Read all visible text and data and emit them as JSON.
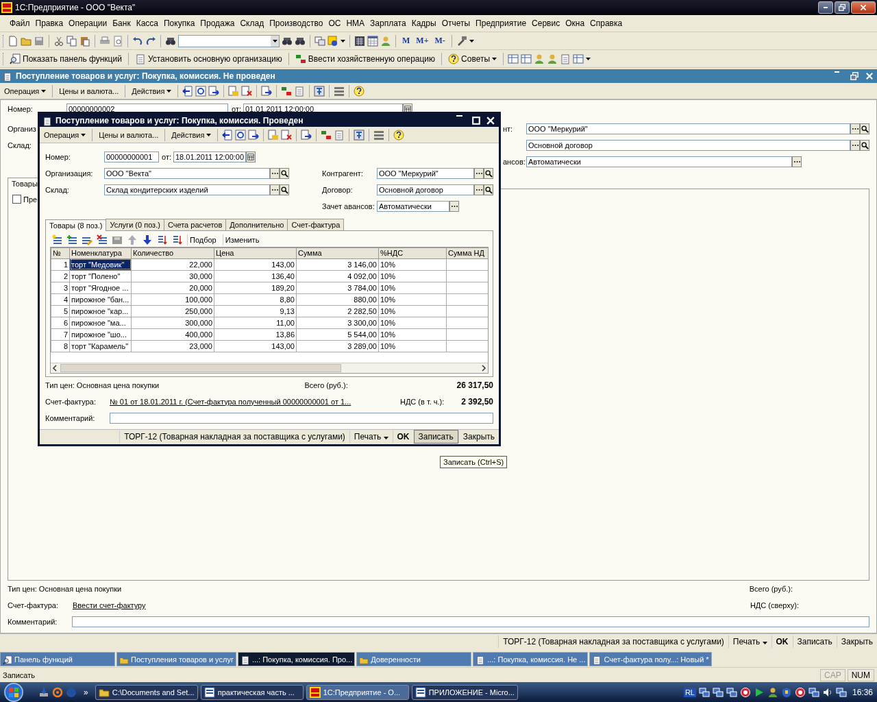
{
  "app_window": {
    "title": "1С:Предприятие - ООО \"Векта\""
  },
  "menu": [
    "Файл",
    "Правка",
    "Операции",
    "Банк",
    "Касса",
    "Покупка",
    "Продажа",
    "Склад",
    "Производство",
    "ОС",
    "НМА",
    "Зарплата",
    "Кадры",
    "Отчеты",
    "Предприятие",
    "Сервис",
    "Окна",
    "Справка"
  ],
  "memory_buttons": [
    "M",
    "M+",
    "M-"
  ],
  "function_toolbar": [
    {
      "label": "Показать панель функций",
      "dropdown": false
    },
    {
      "label": "Установить основную организацию",
      "dropdown": false
    },
    {
      "label": "Ввести хозяйственную операцию",
      "dropdown": false
    },
    {
      "label": "Советы",
      "dropdown": true
    }
  ],
  "document": {
    "title": "Поступление товаров и услуг: Покупка, комиссия. Не проведен",
    "toolbar": [
      {
        "label": "Операция",
        "dropdown": true
      },
      {
        "label": "Цены и валюта...",
        "dropdown": false
      },
      {
        "label": "Действия",
        "dropdown": true
      }
    ],
    "number_label": "Номер:",
    "number": "00000000002",
    "date_label": "от:",
    "date": "01.01.2011 12:00:00",
    "organization_label": "Организ",
    "warehouse_label": "Склад:",
    "counterparty_label": "нт:",
    "counterparty": "ООО \"Меркурий\"",
    "contract": "Основной договор",
    "advance_label": "ансов:",
    "advance": "Автоматически",
    "tab": {
      "label": "Товары",
      "selected": true
    },
    "checkbox": {
      "label": "Пре",
      "checked": false
    },
    "price_type": "Тип цен: Основная цена покупки",
    "total_label": "Всего (руб.):",
    "invoice_label": "Счет-фактура:",
    "invoice_link": "Ввести счет-фактуру",
    "vat_label": "НДС (сверху):",
    "comment_label": "Комментарий:",
    "footer": [
      {
        "label": "ТОРГ-12 (Товарная накладная за поставщика с услугами)",
        "kind": "plain"
      },
      {
        "label": "Печать",
        "kind": "menu"
      },
      {
        "label": "OK",
        "kind": "bold"
      },
      {
        "label": "Записать",
        "kind": "plain"
      },
      {
        "label": "Закрыть",
        "kind": "plain"
      }
    ]
  },
  "dialog": {
    "title": "Поступление товаров и услуг: Покупка, комиссия. Проведен",
    "toolbar": [
      {
        "label": "Операция",
        "dropdown": true
      },
      {
        "label": "Цены и валюта...",
        "dropdown": false
      },
      {
        "label": "Действия",
        "dropdown": true
      }
    ],
    "number_label": "Номер:",
    "number": "00000000001",
    "date_label": "от:",
    "date": "18.01.2011 12:00:00",
    "organization_label": "Организация:",
    "organization": "ООО \"Векта\"",
    "warehouse_label": "Склад:",
    "warehouse": "Склад кондитерских изделий",
    "counterparty_label": "Контрагент:",
    "counterparty": "ООО \"Меркурий\"",
    "contract_label": "Договор:",
    "contract": "Основной договор",
    "advance_label": "Зачет авансов:",
    "advance": "Автоматически",
    "tabs": [
      {
        "label": "Товары (8 поз.)",
        "selected": true
      },
      {
        "label": "Услуги (0 поз.)",
        "selected": false
      },
      {
        "label": "Счета расчетов",
        "selected": false
      },
      {
        "label": "Дополнительно",
        "selected": false
      },
      {
        "label": "Счет-фактура",
        "selected": false
      }
    ],
    "table_toolbar": [
      "Подбор",
      "Изменить"
    ],
    "table": {
      "columns": [
        "№",
        "Номенклатура",
        "Количество",
        "Цена",
        "Сумма",
        "%НДС",
        "Сумма НД"
      ],
      "rows": [
        {
          "cells": [
            "1",
            "торт \"Медовик\"",
            "22,000",
            "143,00",
            "3 146,00",
            "10%"
          ],
          "selected": true
        },
        {
          "cells": [
            "2",
            "торт \"Полено\"",
            "30,000",
            "136,40",
            "4 092,00",
            "10%"
          ],
          "selected": false
        },
        {
          "cells": [
            "3",
            "торт \"Ягодное ...",
            "20,000",
            "189,20",
            "3 784,00",
            "10%"
          ],
          "selected": false
        },
        {
          "cells": [
            "4",
            "пирожное \"бан...",
            "100,000",
            "8,80",
            "880,00",
            "10%"
          ],
          "selected": false
        },
        {
          "cells": [
            "5",
            "пирожное \"кар...",
            "250,000",
            "9,13",
            "2 282,50",
            "10%"
          ],
          "selected": false
        },
        {
          "cells": [
            "6",
            "пирожное \"ма...",
            "300,000",
            "11,00",
            "3 300,00",
            "10%"
          ],
          "selected": false
        },
        {
          "cells": [
            "7",
            "пирожное \"шо...",
            "400,000",
            "13,86",
            "5 544,00",
            "10%"
          ],
          "selected": false
        },
        {
          "cells": [
            "8",
            "торт \"Карамель\"",
            "23,000",
            "143,00",
            "3 289,00",
            "10%"
          ],
          "selected": false
        }
      ]
    },
    "price_type": "Тип цен: Основная цена покупки",
    "total_label": "Всего (руб.):",
    "total": "26 317,50",
    "invoice_label": "Счет-фактура:",
    "invoice_link": "№ 01 от 18.01.2011 г. (Счет-фактура полученный 00000000001 от 1...",
    "vat_label": "НДС (в т. ч.):",
    "vat": "2 392,50",
    "comment_label": "Комментарий:",
    "footer": [
      {
        "label": "ТОРГ-12 (Товарная накладная за поставщика с услугами)",
        "kind": "plain"
      },
      {
        "label": "Печать",
        "kind": "menu"
      },
      {
        "label": "OK",
        "kind": "bold"
      },
      {
        "label": "Записать",
        "kind": "pressed"
      },
      {
        "label": "Закрыть",
        "kind": "plain"
      }
    ]
  },
  "tooltip": "Записать (Ctrl+S)",
  "window_tabs": [
    {
      "label": "Панель функций",
      "selected": false
    },
    {
      "label": "Поступления товаров и услуг",
      "selected": false
    },
    {
      "label": "...: Покупка, комиссия. Про...",
      "selected": true
    },
    {
      "label": "Доверенности",
      "selected": false
    },
    {
      "label": "...: Покупка, комиссия. Не ...",
      "selected": false
    },
    {
      "label": "Счет-фактура полу...: Новый *",
      "selected": false
    }
  ],
  "status_bar": {
    "text": "Записать",
    "indicators": [
      {
        "label": "CAP",
        "on": false
      },
      {
        "label": "NUM",
        "on": true
      }
    ]
  },
  "taskbar": {
    "more": "»",
    "tasks": [
      {
        "label": "C:\\Documents and Set...",
        "selected": false
      },
      {
        "label": "практическая часть ...",
        "selected": false
      },
      {
        "label": "1С:Предприятие - О...",
        "selected": true
      },
      {
        "label": "ПРИЛОЖЕНИЕ - Micro...",
        "selected": false
      }
    ],
    "language": "RL",
    "clock": "16:36"
  }
}
